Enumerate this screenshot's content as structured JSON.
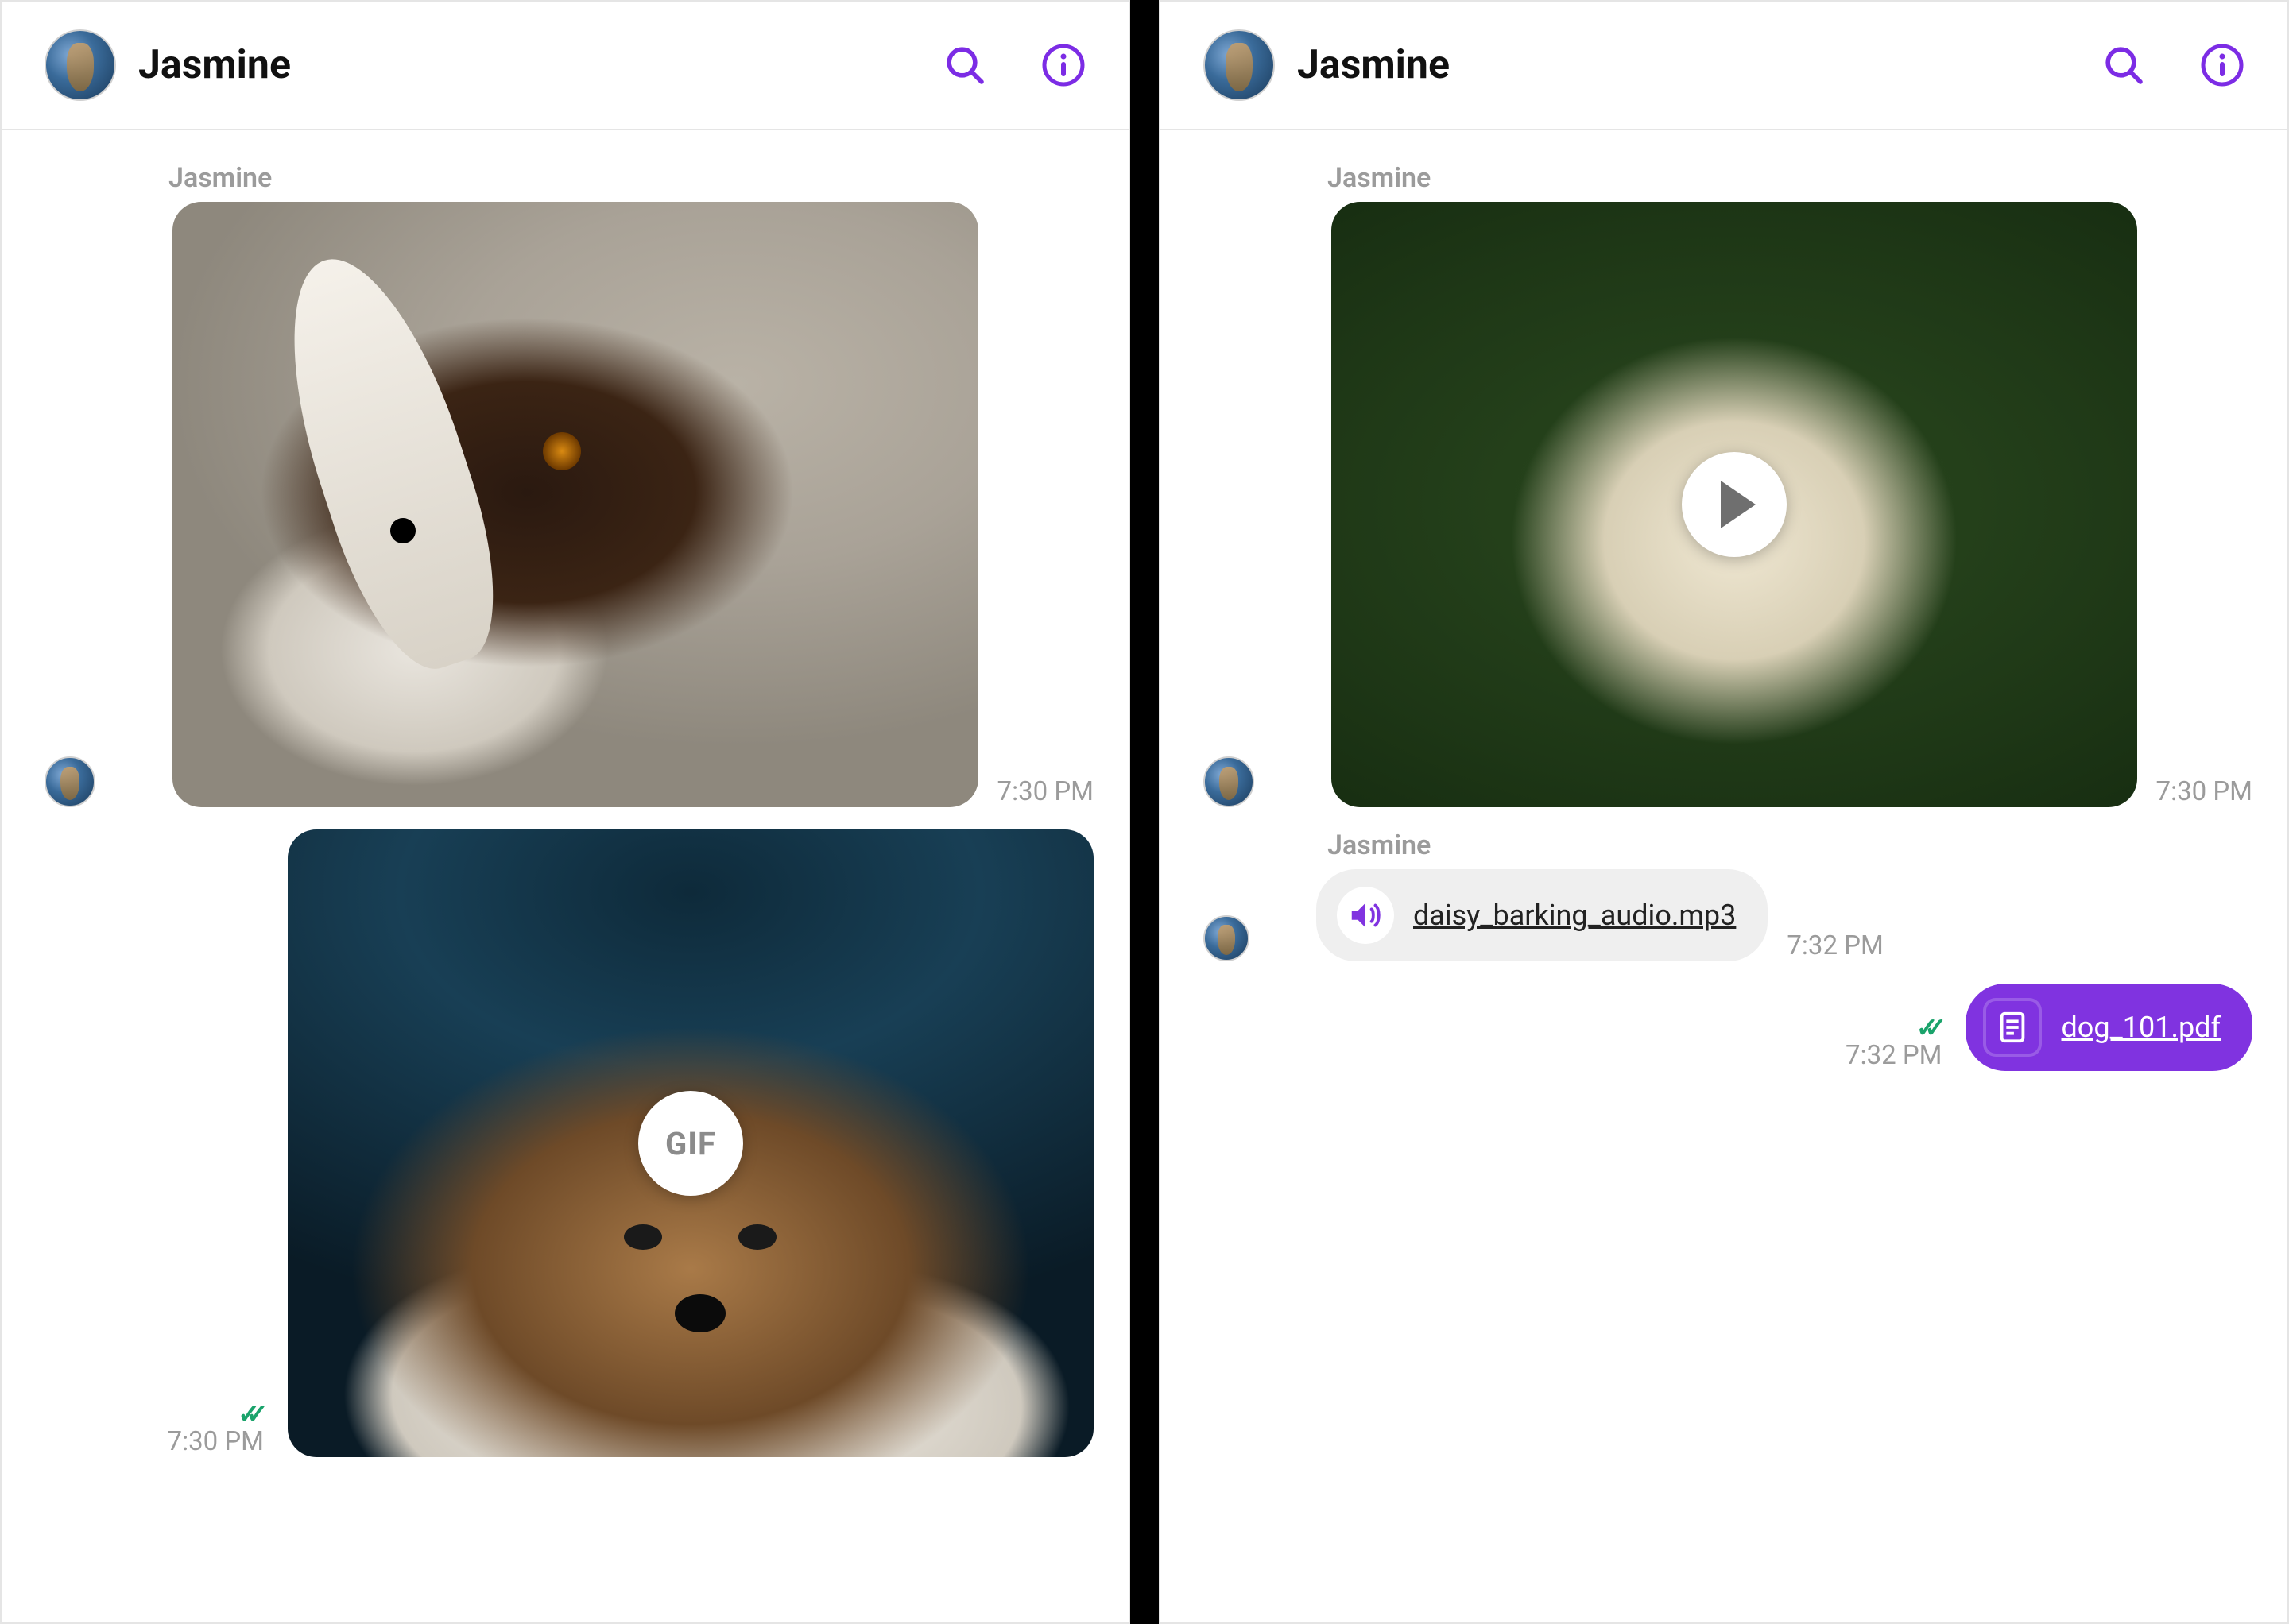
{
  "accent": "#7c2ce5",
  "left": {
    "header": {
      "title": "Jasmine"
    },
    "messages": {
      "incoming_image": {
        "sender": "Jasmine",
        "time": "7:30 PM"
      },
      "outgoing_gif": {
        "badge": "GIF",
        "time": "7:30 PM",
        "read": true
      }
    }
  },
  "right": {
    "header": {
      "title": "Jasmine"
    },
    "messages": {
      "incoming_video": {
        "sender": "Jasmine",
        "time": "7:30 PM"
      },
      "incoming_audio": {
        "sender": "Jasmine",
        "filename": "daisy_barking_audio.mp3",
        "time": "7:32 PM"
      },
      "outgoing_file": {
        "filename": "dog_101.pdf",
        "time": "7:32 PM",
        "read": true
      }
    }
  }
}
